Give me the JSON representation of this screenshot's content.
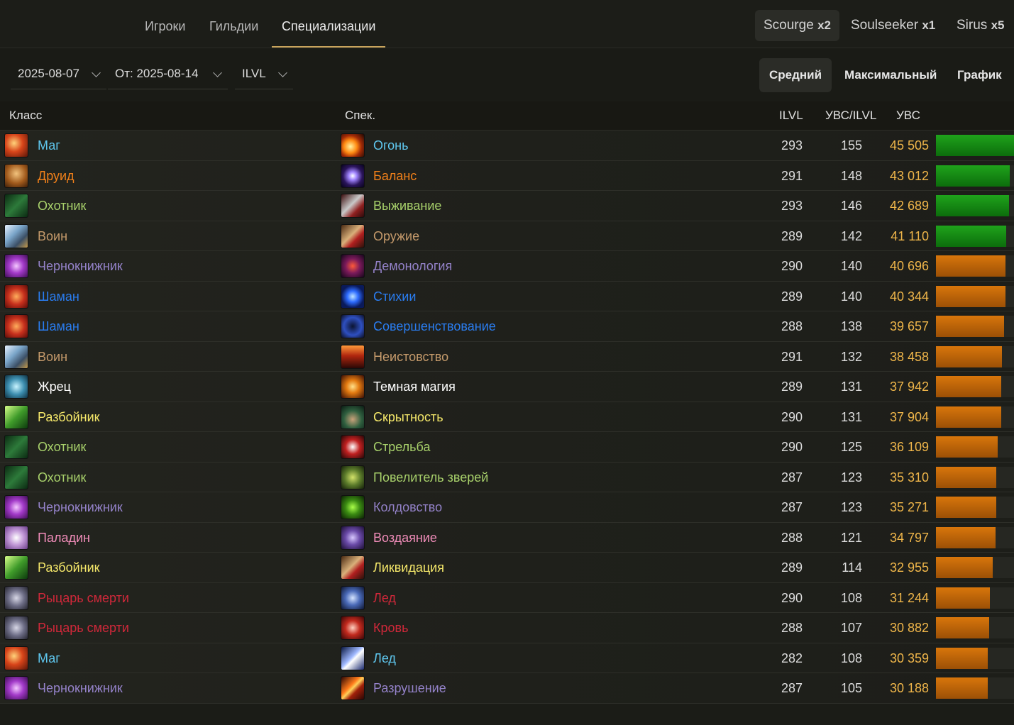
{
  "nav": {
    "tabs": [
      {
        "label": "Игроки",
        "active": false
      },
      {
        "label": "Гильдии",
        "active": false
      },
      {
        "label": "Специализации",
        "active": true
      }
    ],
    "servers": [
      {
        "name": "Scourge",
        "rate": "x2",
        "active": true
      },
      {
        "name": "Soulseeker",
        "rate": "x1",
        "active": false
      },
      {
        "name": "Sirus",
        "rate": "x5",
        "active": false
      }
    ]
  },
  "filters": {
    "date_to": "2025-08-07",
    "date_from": "От: 2025-08-14",
    "metric": "ILVL",
    "modes": [
      {
        "label": "Средний",
        "active": true
      },
      {
        "label": "Максимальный",
        "active": false
      },
      {
        "label": "График",
        "active": false
      }
    ]
  },
  "table": {
    "headers": {
      "class": "Класс",
      "spec": "Спек.",
      "ilvl": "ILVL",
      "ratio": "УВС/ILVL",
      "dps": "УВС"
    },
    "max_dps": 45505,
    "rows": [
      {
        "class": "Маг",
        "spec": "Огонь",
        "ilvl": "293",
        "ratio": "155",
        "dps": "45 505",
        "value": 45505,
        "class_color": "#5fc8f0",
        "spec_color": "#5fc8f0",
        "class_icon": "mage-icon",
        "spec_icon": "fire-icon",
        "bar": "green"
      },
      {
        "class": "Друид",
        "spec": "Баланс",
        "ilvl": "291",
        "ratio": "148",
        "dps": "43 012",
        "value": 43012,
        "class_color": "#f0801a",
        "spec_color": "#f0801a",
        "class_icon": "druid-icon",
        "spec_icon": "balance-icon",
        "bar": "green"
      },
      {
        "class": "Охотник",
        "spec": "Выживание",
        "ilvl": "293",
        "ratio": "146",
        "dps": "42 689",
        "value": 42689,
        "class_color": "#a8d16b",
        "spec_color": "#a8d16b",
        "class_icon": "hunter-icon",
        "spec_icon": "survival-icon",
        "bar": "green"
      },
      {
        "class": "Воин",
        "spec": "Оружие",
        "ilvl": "289",
        "ratio": "142",
        "dps": "41 110",
        "value": 41110,
        "class_color": "#c59a6b",
        "spec_color": "#c59a6b",
        "class_icon": "warrior-icon",
        "spec_icon": "arms-icon",
        "bar": "green"
      },
      {
        "class": "Чернокнижник",
        "spec": "Демонология",
        "ilvl": "290",
        "ratio": "140",
        "dps": "40 696",
        "value": 40696,
        "class_color": "#9482c9",
        "spec_color": "#9482c9",
        "class_icon": "warlock-icon",
        "spec_icon": "demonology-icon",
        "bar": "orange"
      },
      {
        "class": "Шаман",
        "spec": "Стихии",
        "ilvl": "289",
        "ratio": "140",
        "dps": "40 344",
        "value": 40344,
        "class_color": "#2a7df0",
        "spec_color": "#2a7df0",
        "class_icon": "shaman-icon",
        "spec_icon": "elemental-icon",
        "bar": "orange"
      },
      {
        "class": "Шаман",
        "spec": "Совершенствование",
        "ilvl": "288",
        "ratio": "138",
        "dps": "39 657",
        "value": 39657,
        "class_color": "#2a7df0",
        "spec_color": "#2a7df0",
        "class_icon": "shaman-icon",
        "spec_icon": "enhancement-icon",
        "bar": "orange"
      },
      {
        "class": "Воин",
        "spec": "Неистовство",
        "ilvl": "291",
        "ratio": "132",
        "dps": "38 458",
        "value": 38458,
        "class_color": "#c59a6b",
        "spec_color": "#c59a6b",
        "class_icon": "warrior-icon",
        "spec_icon": "fury-icon",
        "bar": "orange"
      },
      {
        "class": "Жрец",
        "spec": "Темная магия",
        "ilvl": "289",
        "ratio": "131",
        "dps": "37 942",
        "value": 37942,
        "class_color": "#ffffff",
        "spec_color": "#ffffff",
        "class_icon": "priest-icon",
        "spec_icon": "shadow-icon",
        "bar": "orange"
      },
      {
        "class": "Разбойник",
        "spec": "Скрытность",
        "ilvl": "290",
        "ratio": "131",
        "dps": "37 904",
        "value": 37904,
        "class_color": "#f5e86a",
        "spec_color": "#f5e86a",
        "class_icon": "rogue-icon",
        "spec_icon": "subtlety-icon",
        "bar": "orange"
      },
      {
        "class": "Охотник",
        "spec": "Стрельба",
        "ilvl": "290",
        "ratio": "125",
        "dps": "36 109",
        "value": 36109,
        "class_color": "#a8d16b",
        "spec_color": "#a8d16b",
        "class_icon": "hunter-icon",
        "spec_icon": "marksmanship-icon",
        "bar": "orange"
      },
      {
        "class": "Охотник",
        "spec": "Повелитель зверей",
        "ilvl": "287",
        "ratio": "123",
        "dps": "35 310",
        "value": 35310,
        "class_color": "#a8d16b",
        "spec_color": "#a8d16b",
        "class_icon": "hunter-icon",
        "spec_icon": "beastmastery-icon",
        "bar": "orange"
      },
      {
        "class": "Чернокнижник",
        "spec": "Колдовство",
        "ilvl": "287",
        "ratio": "123",
        "dps": "35 271",
        "value": 35271,
        "class_color": "#9482c9",
        "spec_color": "#9482c9",
        "class_icon": "warlock-icon",
        "spec_icon": "affliction-icon",
        "bar": "orange"
      },
      {
        "class": "Паладин",
        "spec": "Воздаяние",
        "ilvl": "288",
        "ratio": "121",
        "dps": "34 797",
        "value": 34797,
        "class_color": "#f08cb9",
        "spec_color": "#f08cb9",
        "class_icon": "paladin-icon",
        "spec_icon": "retribution-icon",
        "bar": "orange"
      },
      {
        "class": "Разбойник",
        "spec": "Ликвидация",
        "ilvl": "289",
        "ratio": "114",
        "dps": "32 955",
        "value": 32955,
        "class_color": "#f5e86a",
        "spec_color": "#f5e86a",
        "class_icon": "rogue-icon",
        "spec_icon": "assassination-icon",
        "bar": "orange"
      },
      {
        "class": "Рыцарь смерти",
        "spec": "Лед",
        "ilvl": "290",
        "ratio": "108",
        "dps": "31 244",
        "value": 31244,
        "class_color": "#d0283a",
        "spec_color": "#d0283a",
        "class_icon": "deathknight-icon",
        "spec_icon": "frost-dk-icon",
        "bar": "orange"
      },
      {
        "class": "Рыцарь смерти",
        "spec": "Кровь",
        "ilvl": "288",
        "ratio": "107",
        "dps": "30 882",
        "value": 30882,
        "class_color": "#d0283a",
        "spec_color": "#d0283a",
        "class_icon": "deathknight-icon",
        "spec_icon": "blood-icon",
        "bar": "orange"
      },
      {
        "class": "Маг",
        "spec": "Лед",
        "ilvl": "282",
        "ratio": "108",
        "dps": "30 359",
        "value": 30359,
        "class_color": "#5fc8f0",
        "spec_color": "#5fc8f0",
        "class_icon": "mage-icon",
        "spec_icon": "frost-mage-icon",
        "bar": "orange"
      },
      {
        "class": "Чернокнижник",
        "spec": "Разрушение",
        "ilvl": "287",
        "ratio": "105",
        "dps": "30 188",
        "value": 30188,
        "class_color": "#9482c9",
        "spec_color": "#9482c9",
        "class_icon": "warlock-icon",
        "spec_icon": "destruction-icon",
        "bar": "orange"
      }
    ]
  }
}
